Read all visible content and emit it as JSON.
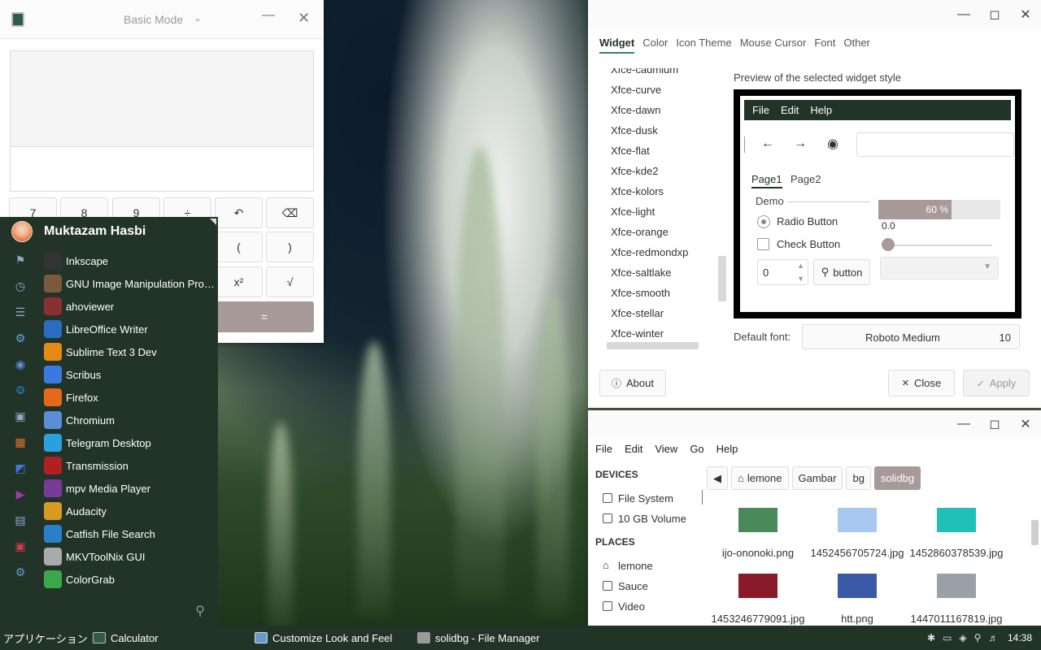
{
  "calculator": {
    "mode": "Basic Mode",
    "buttons": [
      "7",
      "8",
      "9",
      "÷",
      "↶",
      "⌫",
      "(",
      ")",
      "x²",
      "√",
      "="
    ]
  },
  "menu": {
    "user": "Muktazam Hasbi",
    "apps": [
      {
        "label": "Inkscape",
        "icon": "inkscape-icon",
        "color": "#333333"
      },
      {
        "label": "GNU Image Manipulation Prog...",
        "icon": "gimp-icon",
        "color": "#7a5a3a"
      },
      {
        "label": "ahoviewer",
        "icon": "ahoviewer-icon",
        "color": "#8a3030"
      },
      {
        "label": "LibreOffice Writer",
        "icon": "writer-icon",
        "color": "#2a6bc4"
      },
      {
        "label": "Sublime Text 3 Dev",
        "icon": "sublime-icon",
        "color": "#e68a16"
      },
      {
        "label": "Scribus",
        "icon": "scribus-icon",
        "color": "#3a7ae0"
      },
      {
        "label": "Firefox",
        "icon": "firefox-icon",
        "color": "#e8681a"
      },
      {
        "label": "Chromium",
        "icon": "chromium-icon",
        "color": "#5a8ed8"
      },
      {
        "label": "Telegram Desktop",
        "icon": "telegram-icon",
        "color": "#2aa0e0"
      },
      {
        "label": "Transmission",
        "icon": "transmission-icon",
        "color": "#b02020"
      },
      {
        "label": "mpv Media Player",
        "icon": "mpv-icon",
        "color": "#7a3a9a"
      },
      {
        "label": "Audacity",
        "icon": "audacity-icon",
        "color": "#d89a20"
      },
      {
        "label": "Catfish File Search",
        "icon": "catfish-icon",
        "color": "#2a80c8"
      },
      {
        "label": "MKVToolNix GUI",
        "icon": "mkvtoolnix-icon",
        "color": "#aaaaaa"
      },
      {
        "label": "ColorGrab",
        "icon": "colorgrab-icon",
        "color": "#3aa84a"
      }
    ],
    "categories": [
      "bookmark-icon",
      "clock-icon",
      "list-icon",
      "settings-icon",
      "chromium-icon",
      "gear-icon",
      "gamepad-icon",
      "graphics-icon",
      "internet-icon",
      "multimedia-icon",
      "office-icon",
      "system-icon",
      "settings-manager-icon"
    ]
  },
  "appearance": {
    "tabs": [
      "Widget",
      "Color",
      "Icon Theme",
      "Mouse Cursor",
      "Font",
      "Other"
    ],
    "themes": [
      "Xfce-cadmium",
      "Xfce-curve",
      "Xfce-dawn",
      "Xfce-dusk",
      "Xfce-flat",
      "Xfce-kde2",
      "Xfce-kolors",
      "Xfce-light",
      "Xfce-orange",
      "Xfce-redmondxp",
      "Xfce-saltlake",
      "Xfce-smooth",
      "Xfce-stellar",
      "Xfce-winter"
    ],
    "preview_label": "Preview of the selected widget style",
    "preview": {
      "menus": [
        "File",
        "Edit",
        "Help"
      ],
      "tabs": [
        "Page1",
        "Page2"
      ],
      "frame": "Demo",
      "radio": "Radio Button",
      "check": "Check Button",
      "spin_value": "0",
      "button": "button",
      "progress_text": "60 %",
      "progress_value": 0.6,
      "slider_value": "0.0"
    },
    "default_font_label": "Default font:",
    "default_font": "Roboto Medium",
    "default_font_size": "10",
    "about": "About",
    "close": "Close",
    "apply": "Apply"
  },
  "filemanager": {
    "menus": [
      "File",
      "Edit",
      "View",
      "Go",
      "Help"
    ],
    "devices_header": "DEVICES",
    "devices": [
      "File System",
      "10 GB Volume"
    ],
    "places_header": "PLACES",
    "places": [
      "lemone",
      "Sauce",
      "Video"
    ],
    "path": [
      "lemone",
      "Gambar",
      "bg",
      "solidbg"
    ],
    "files": [
      {
        "name": "ijo-ononoki.png",
        "color": "#4a8a5a"
      },
      {
        "name": "1452456705724.jpg",
        "color": "#a8c8f0"
      },
      {
        "name": "1452860378539.jpg",
        "color": "#20c0b8"
      },
      {
        "name": "1453246779091.jpg",
        "color": "#8a1a2a"
      },
      {
        "name": "htt.png",
        "color": "#3a5aa8"
      },
      {
        "name": "1447011167819.jpg",
        "color": "#9aa0a8"
      }
    ]
  },
  "taskbar": {
    "apps_label": "アプリケーション",
    "items": [
      "Calculator",
      "Customize Look and Feel",
      "solidbg - File Manager"
    ],
    "clock": "14:38"
  }
}
